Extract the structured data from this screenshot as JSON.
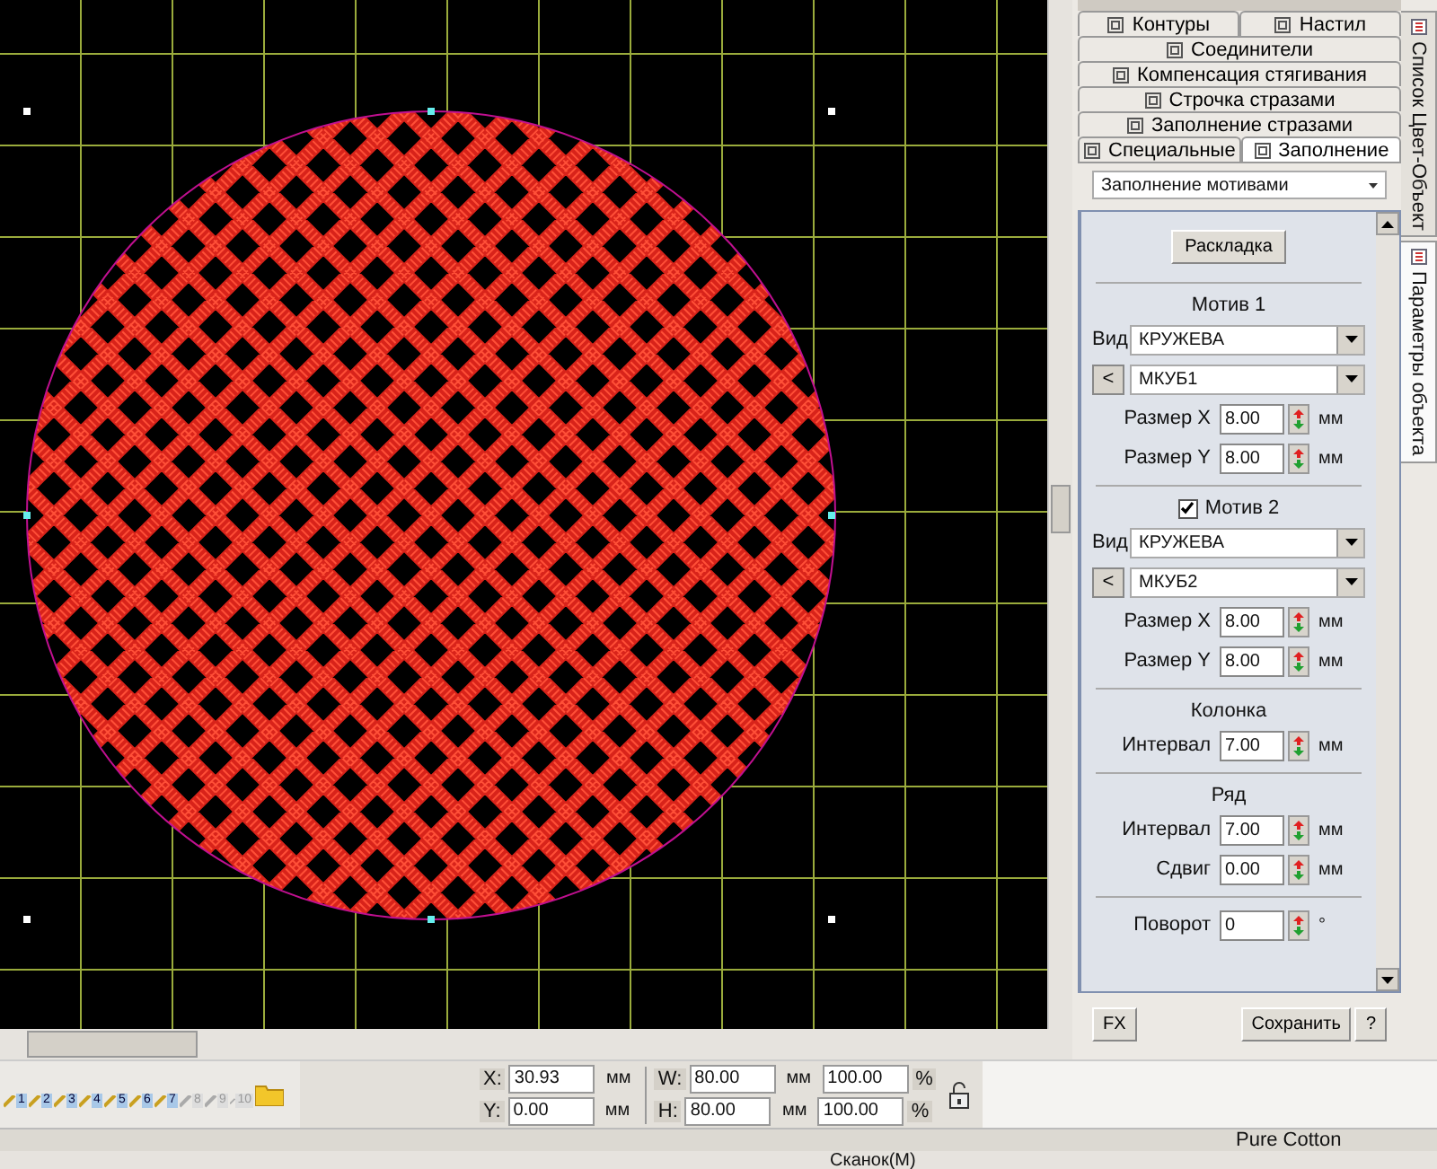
{
  "panel": {
    "tab_rows": [
      [
        {
          "label": "Контуры",
          "selected": false
        },
        {
          "label": "Настил",
          "selected": false
        }
      ],
      [
        {
          "label": "Соединители",
          "selected": false
        }
      ],
      [
        {
          "label": "Компенсация стягивания",
          "selected": false
        }
      ],
      [
        {
          "label": "Строчка стразами",
          "selected": false
        }
      ],
      [
        {
          "label": "Заполнение стразами",
          "selected": false
        }
      ],
      [
        {
          "label": "Специальные",
          "selected": false
        },
        {
          "label": "Заполнение",
          "selected": true
        }
      ]
    ],
    "fill_type": "Заполнение мотивами",
    "layout_button": "Раскладка",
    "sections": [
      {
        "kind": "motif",
        "title": "Мотив 1",
        "kind_label": "Вид",
        "kind_value": "КРУЖЕВА",
        "prev_button": "<",
        "pattern_value": "МКУБ1",
        "fields": [
          {
            "label": "Размер X",
            "value": "8.00",
            "unit": "мм"
          },
          {
            "label": "Размер Y",
            "value": "8.00",
            "unit": "мм"
          }
        ]
      },
      {
        "kind": "motif",
        "title": "Мотив 2",
        "checked": true,
        "kind_label": "Вид",
        "kind_value": "КРУЖЕВА",
        "prev_button": "<",
        "pattern_value": "МКУБ2",
        "fields": [
          {
            "label": "Размер X",
            "value": "8.00",
            "unit": "мм"
          },
          {
            "label": "Размер Y",
            "value": "8.00",
            "unit": "мм"
          }
        ]
      },
      {
        "kind": "fields",
        "title": "Колонка",
        "fields": [
          {
            "label": "Интервал",
            "value": "7.00",
            "unit": "мм"
          }
        ]
      },
      {
        "kind": "fields",
        "title": "Ряд",
        "fields": [
          {
            "label": "Интервал",
            "value": "7.00",
            "unit": "мм"
          },
          {
            "label": "Сдвиг",
            "value": "0.00",
            "unit": "мм"
          }
        ]
      },
      {
        "kind": "fields",
        "fields": [
          {
            "label": "Поворот",
            "value": "0",
            "unit": "°"
          }
        ]
      }
    ],
    "left_buttons": [
      "FX"
    ],
    "right_buttons": [
      "Сохранить",
      "?"
    ]
  },
  "side_tabs": [
    {
      "label": "Список Цвет-Объект",
      "selected": false
    },
    {
      "label": "Параметры объекта",
      "selected": true
    }
  ],
  "color_slots": [
    {
      "label": "1",
      "disabled": false
    },
    {
      "label": "2",
      "disabled": false
    },
    {
      "label": "3",
      "disabled": false
    },
    {
      "label": "4",
      "disabled": false
    },
    {
      "label": "5",
      "disabled": false
    },
    {
      "label": "6",
      "disabled": false
    },
    {
      "label": "7",
      "disabled": false
    },
    {
      "label": "8",
      "disabled": true
    },
    {
      "label": "9",
      "disabled": true
    },
    {
      "label": "10",
      "disabled": true
    }
  ],
  "coords": [
    {
      "label": "X:",
      "value": "30.93",
      "unit": "мм"
    },
    {
      "label": "Y:",
      "value": "0.00",
      "unit": "мм"
    }
  ],
  "size": [
    {
      "label": "W:",
      "value": "80.00",
      "unit": "мм",
      "percent": "100.00",
      "percent_unit": "%"
    },
    {
      "label": "H:",
      "value": "80.00",
      "unit": "мм",
      "percent": "100.00",
      "percent_unit": "%"
    }
  ],
  "status_bar": {
    "fabric": "Pure Cotton",
    "bottom": "Сканок(М)"
  }
}
